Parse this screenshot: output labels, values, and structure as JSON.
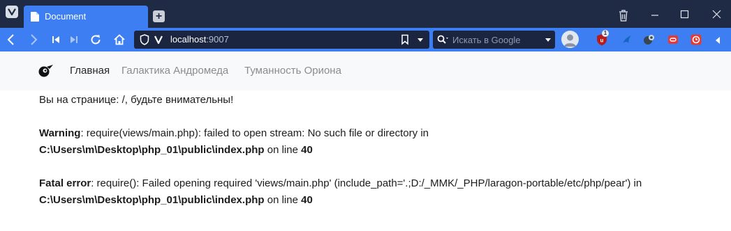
{
  "browser": {
    "tab_title": "Document",
    "url_host": "localhost",
    "url_port": ":9007",
    "search_placeholder": "Искать в Google",
    "extension_badge": "1",
    "colors": {
      "tabbar": "#1f2b45",
      "accent": "#3d7ff2",
      "field": "#1b2540"
    }
  },
  "site_nav": {
    "links": [
      {
        "label": "Главная",
        "active": true
      },
      {
        "label": "Галактика Андромеда",
        "active": false
      },
      {
        "label": "Туманность Ориона",
        "active": false
      }
    ]
  },
  "page": {
    "intro": "Вы на странице: /, будьте внимательны!",
    "warning": {
      "label": "Warning",
      "message": ": require(views/main.php): failed to open stream: No such file or directory in",
      "file": "C:\\Users\\m\\Desktop\\php_01\\public\\index.php",
      "on_line": " on line ",
      "line": "40"
    },
    "fatal": {
      "label": "Fatal error",
      "message": ": require(): Failed opening required 'views/main.php' (include_path='.;D:/_MMK/_PHP/laragon-portable/etc/php/pear') in",
      "file": "C:\\Users\\m\\Desktop\\php_01\\public\\index.php",
      "on_line": " on line ",
      "line": "40"
    }
  }
}
